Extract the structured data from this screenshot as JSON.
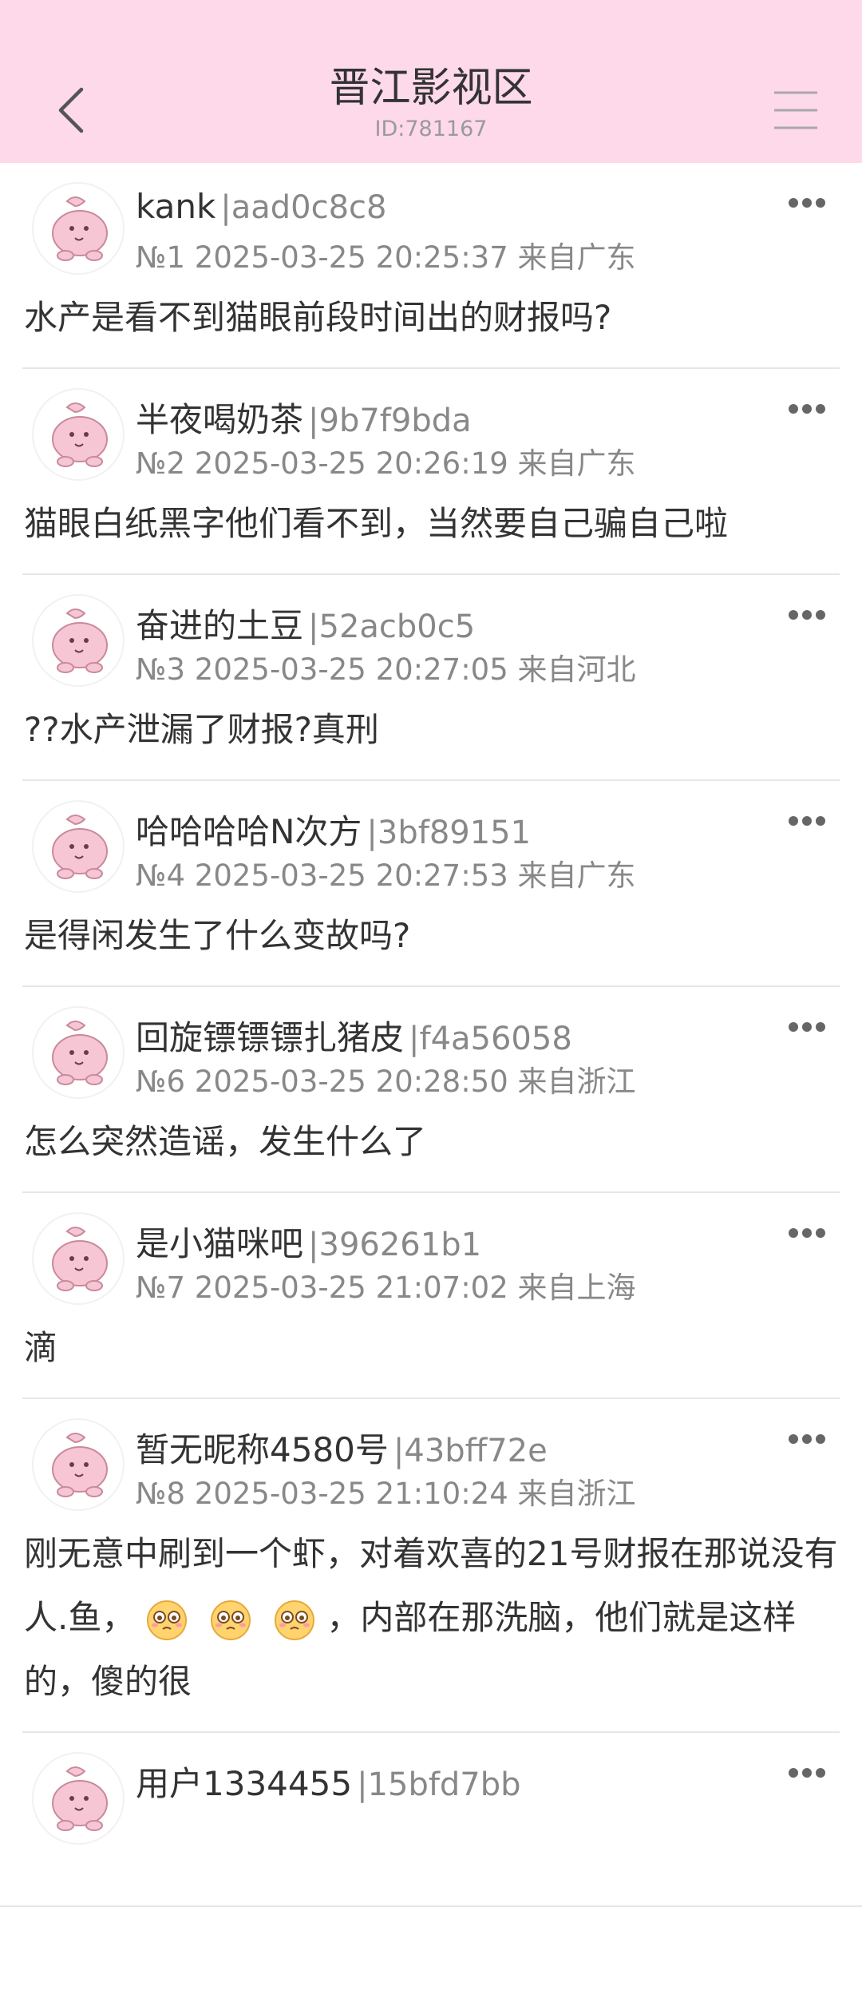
{
  "header": {
    "title": "晋江影视区",
    "subtitle": "ID:781167",
    "back_icon": "chevron-left-icon",
    "menu_icon": "hamburger-menu-icon",
    "bg_color": "#fdd9ea"
  },
  "posts": [
    {
      "name": "kank",
      "uid": "|aad0c8c8",
      "floor": "№1",
      "time": "2025-03-25 20:25:37",
      "location": "来自广东",
      "text": "水产是看不到猫眼前段时间出的财报吗?"
    },
    {
      "name": "半夜喝奶茶",
      "uid": "|9b7f9bda",
      "floor": "№2",
      "time": "2025-03-25 20:26:19",
      "location": "来自广东",
      "text": "猫眼白纸黑字他们看不到，当然要自己骗自己啦"
    },
    {
      "name": "奋进的土豆",
      "uid": "|52acb0c5",
      "floor": "№3",
      "time": "2025-03-25 20:27:05",
      "location": "来自河北",
      "text": "??水产泄漏了财报?真刑"
    },
    {
      "name": "哈哈哈哈N次方",
      "uid": "|3bf89151",
      "floor": "№4",
      "time": "2025-03-25 20:27:53",
      "location": "来自广东",
      "text": "是得闲发生了什么变故吗?"
    },
    {
      "name": "回旋镖镖镖扎猪皮",
      "uid": "|f4a56058",
      "floor": "№6",
      "time": "2025-03-25 20:28:50",
      "location": "来自浙江",
      "text": "怎么突然造谣，发生什么了"
    },
    {
      "name": "是小猫咪吧",
      "uid": "|396261b1",
      "floor": "№7",
      "time": "2025-03-25 21:07:02",
      "location": "来自上海",
      "text": "滴"
    },
    {
      "name": "暂无昵称4580号",
      "uid": "|43bff72e",
      "floor": "№8",
      "time": "2025-03-25 21:10:24",
      "location": "来自浙江",
      "text_a": "刚无意中刷到一个虾，对着欢喜的21号财报在那说没有人.鱼，",
      "text_b": "，内部在那洗脑，他们就是这样的，傻的很"
    },
    {
      "name": "用户1334455",
      "uid": "|15bfd7bb"
    }
  ]
}
